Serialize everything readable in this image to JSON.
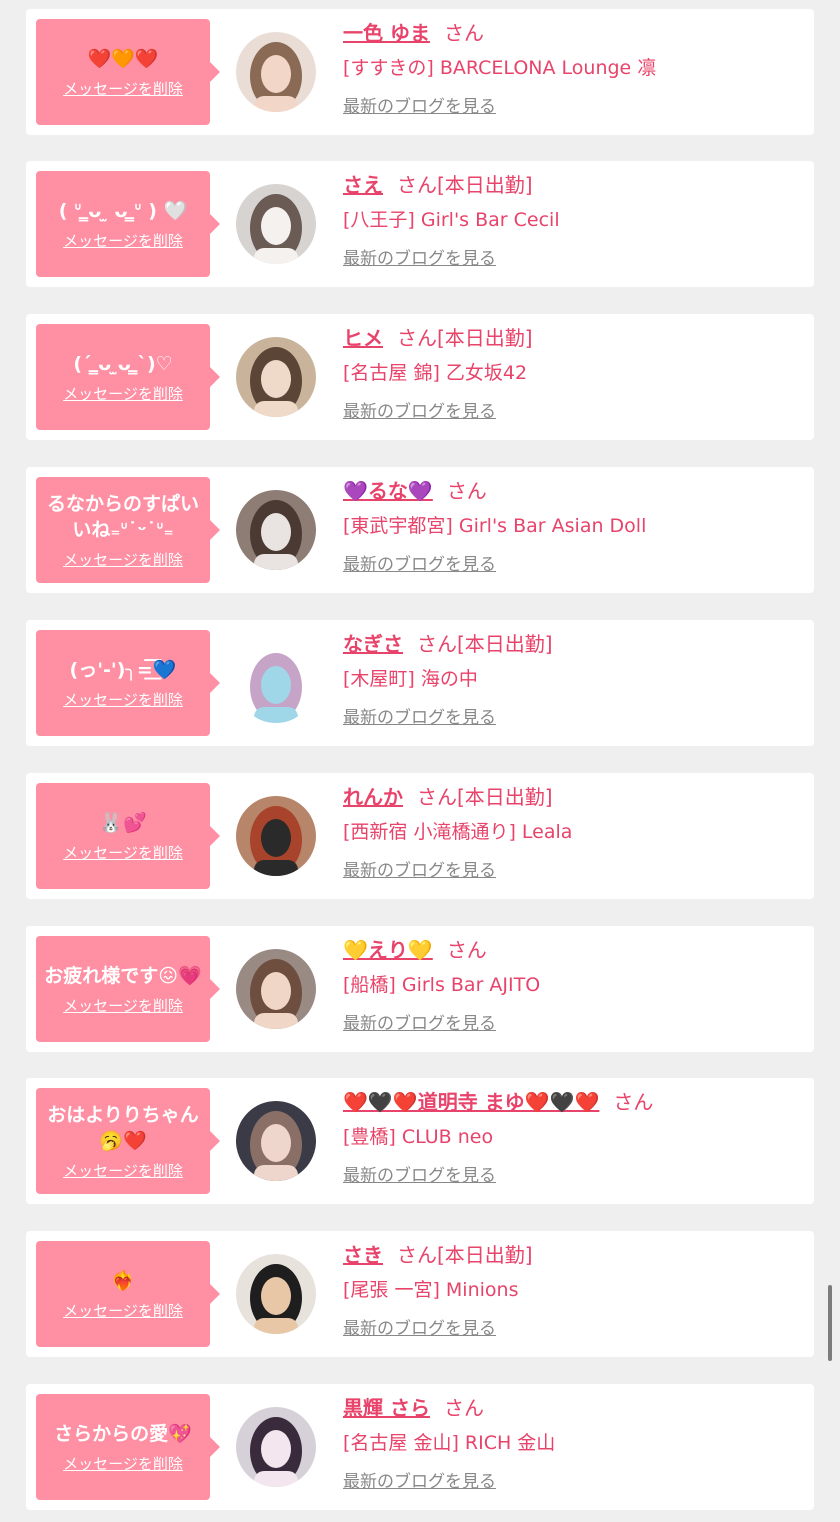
{
  "ui": {
    "delete_label": "メッセージを削除",
    "san_suffix": "さん",
    "blog_link_label": "最新のブログを見る"
  },
  "items": [
    {
      "message": "❤️🧡❤️",
      "name": "一色 ゆま",
      "status": "",
      "shop": "[すすきの] BARCELONA Lounge 凛",
      "avatar_colors": [
        "#e9ddd6",
        "#8a6a55",
        "#f2d7c8"
      ]
    },
    {
      "message": "( ᐡ ̳ᴗ  ̫ ᴗ ̳ᐡ ) 🤍",
      "name": "さえ",
      "status": "[本日出勤]",
      "shop": "[八王子] Girl's Bar Cecil",
      "avatar_colors": [
        "#d7d3d0",
        "#6b5b55",
        "#f4f1ef"
      ]
    },
    {
      "message": "(ˊ ̳ᴗ ̫ᴗ ̳ˋ)♡",
      "name": "ヒメ",
      "status": "[本日出勤]",
      "shop": "[名古屋 錦] 乙女坂42",
      "avatar_colors": [
        "#c9b49b",
        "#5a4536",
        "#efd9c8"
      ]
    },
    {
      "message": "るなからのすぱいいね₌ᐡ˙ᵕ˙ᐡ₌",
      "name": "💜るな💜",
      "status": "",
      "shop": "[東武宇都宮] Girl's Bar Asian Doll",
      "avatar_colors": [
        "#8e7d74",
        "#4a3a33",
        "#e9e4e1"
      ]
    },
    {
      "message": "(っ'-')╮=͟͟͞͞💙",
      "name": "なぎさ",
      "status": "[本日出勤]",
      "shop": "[木屋町] 海の中",
      "avatar_colors": [
        "#ffffff",
        "#c6a4c8",
        "#9fd7e8"
      ]
    },
    {
      "message": "🐰💕",
      "name": "れんか",
      "status": "[本日出勤]",
      "shop": "[西新宿 小滝橋通り] Leala",
      "avatar_colors": [
        "#b7856a",
        "#a8442c",
        "#2a2a2a"
      ]
    },
    {
      "message": "お疲れ様です😖💗",
      "name": "💛えり💛",
      "status": "",
      "shop": "[船橋] Girls Bar AJITO",
      "avatar_colors": [
        "#9a8a84",
        "#6e4e3e",
        "#f0d6c6"
      ]
    },
    {
      "message": "おはよりりちゃん🥱❤️",
      "name": "❤️🖤❤️道明寺 まゆ❤️🖤❤️",
      "status": "",
      "shop": "[豊橋] CLUB neo",
      "avatar_colors": [
        "#3b3b47",
        "#8a6f66",
        "#efd6cc"
      ]
    },
    {
      "message": "❤️‍🔥",
      "name": "さき",
      "status": "[本日出勤]",
      "shop": "[尾張 一宮] Minions",
      "avatar_colors": [
        "#e7e2dc",
        "#1e1e1e",
        "#e8c7a6"
      ]
    },
    {
      "message": "さらからの愛💖",
      "name": "黒輝 さら",
      "status": "",
      "shop": "[名古屋 金山] RICH 金山",
      "avatar_colors": [
        "#d6d0d8",
        "#3a2b3c",
        "#f3e6ee"
      ]
    }
  ]
}
